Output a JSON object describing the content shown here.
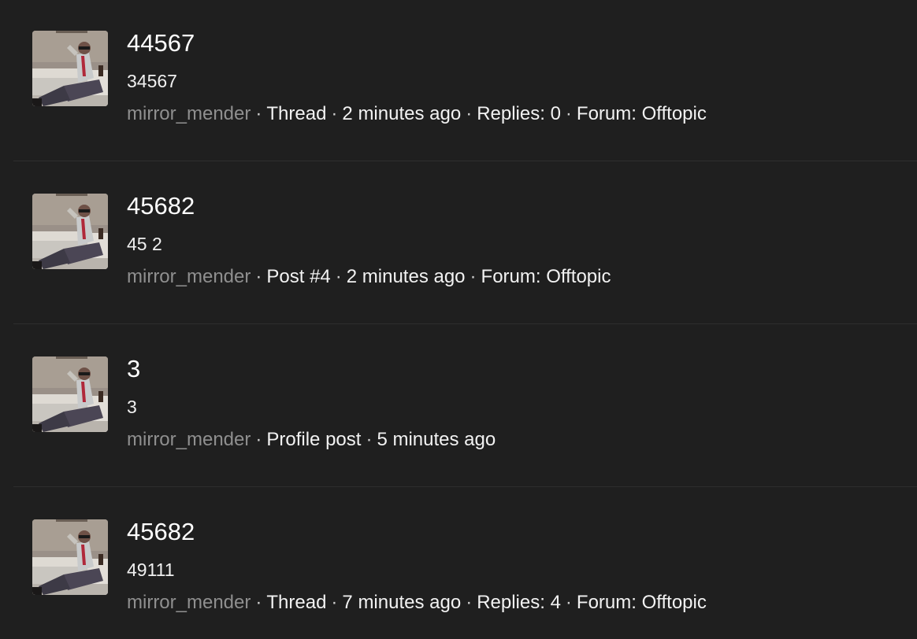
{
  "separator": "·",
  "results": [
    {
      "title": "44567",
      "snippet": "34567",
      "username": "mirror_mender",
      "type": "Thread",
      "time": "2 minutes ago",
      "replies": "Replies: 0",
      "forum": "Forum: Offtopic"
    },
    {
      "title": "45682",
      "snippet": "45 2",
      "username": "mirror_mender",
      "type": "Post #4",
      "time": "2 minutes ago",
      "forum": "Forum: Offtopic"
    },
    {
      "title": "3",
      "snippet": "3",
      "username": "mirror_mender",
      "type": "Profile post",
      "time": "5 minutes ago"
    },
    {
      "title": "45682",
      "snippet": "49111",
      "username": "mirror_mender",
      "type": "Thread",
      "time": "7 minutes ago",
      "replies": "Replies: 4",
      "forum": "Forum: Offtopic"
    }
  ]
}
